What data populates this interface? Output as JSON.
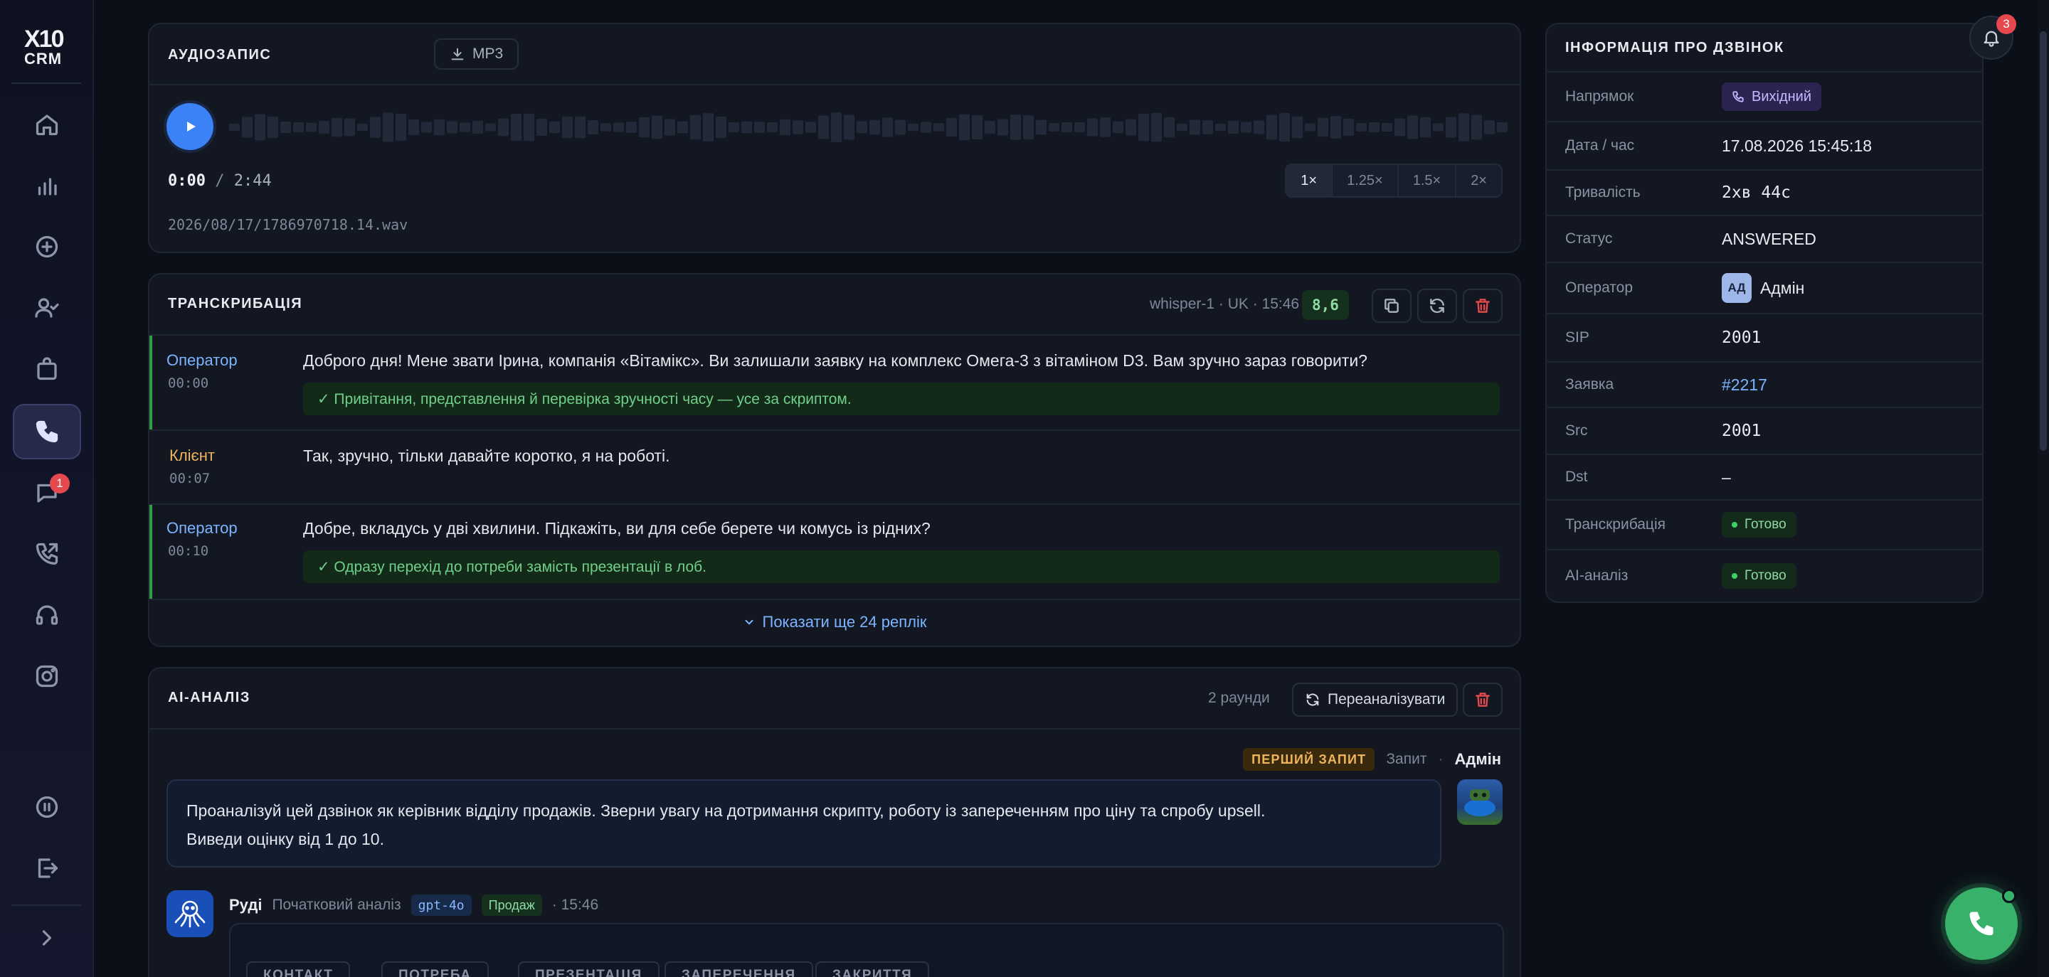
{
  "sidebar": {
    "logo_top": "X10",
    "logo_bottom": "CRM",
    "items": [
      {
        "icon": "home-icon"
      },
      {
        "icon": "chart-icon"
      },
      {
        "icon": "plus-circle-icon"
      },
      {
        "icon": "user-check-icon"
      },
      {
        "icon": "bag-icon"
      },
      {
        "icon": "phone-icon",
        "active": true
      },
      {
        "icon": "chat-icon",
        "badge": "1"
      },
      {
        "icon": "phone-outgoing-icon"
      },
      {
        "icon": "headset-icon"
      },
      {
        "icon": "instagram-icon"
      },
      {
        "icon": "pause-icon"
      },
      {
        "icon": "logout-icon"
      },
      {
        "icon": "chevron-right-icon"
      }
    ]
  },
  "audio": {
    "title": "АУДІОЗАПИС",
    "download_label": "MP3",
    "time_current": "0:00",
    "time_separator": "/",
    "time_total": "2:44",
    "speeds": [
      "1×",
      "1.25×",
      "1.5×",
      "2×"
    ],
    "file_path": "2026/08/17/1786970718.14.wav"
  },
  "transcription": {
    "title": "ТРАНСКРИБАЦІЯ",
    "meta": "whisper-1 · UK · 15:46",
    "score": "8,6",
    "rows": [
      {
        "role": "Оператор",
        "time": "00:00",
        "text": "Доброго дня! Мене звати Ірина, компанія «Вітамікс». Ви залишали заявку на комплекс Омега-3 з вітаміном D3. Вам зручно зараз говорити?",
        "note": "✓  Привітання, представлення й перевірка зручності часу — усе за скриптом."
      },
      {
        "role": "Клієнт",
        "time": "00:07",
        "text": "Так, зручно, тільки давайте коротко, я на роботі."
      },
      {
        "role": "Оператор",
        "time": "00:10",
        "text": "Добре, вкладусь у дві хвилини. Підкажіть, ви для себе берете чи комусь із рідних?",
        "note": "✓  Одразу перехід до потреби замість презентації в лоб."
      }
    ],
    "show_more": "Показати ще 24 реплік"
  },
  "ai": {
    "title": "AI-АНАЛІЗ",
    "rounds": "2 раунди",
    "reanalyze_label": "Переаналізувати",
    "request_badge": "ПЕРШИЙ ЗАПИТ",
    "request_label": "Запит",
    "request_dot": "·",
    "request_author": "Адмін",
    "request_text_1": "Проаналізуй цей дзвінок як керівник відділу продажів. Зверни увагу на дотримання скрипту, роботу із запереченням про ціну та спробу upsell.",
    "request_text_2": "Виведи оцінку від 1 до 10.",
    "bot_name": "Руді",
    "bot_subtitle": "Початковий аналіз",
    "bot_model": "gpt-4o",
    "bot_tag": "Продаж",
    "bot_time": "· 15:46",
    "tabs": [
      "КОНТАКТ",
      "ПОТРЕБА",
      "ПРЕЗЕНТАЦІЯ",
      "ЗАПЕРЕЧЕННЯ",
      "ЗАКРИТТЯ"
    ]
  },
  "info": {
    "title": "ІНФОРМАЦІЯ ПРО ДЗВІНОК",
    "rows": [
      {
        "key": "Напрямок",
        "value": "Вихідний"
      },
      {
        "key": "Дата / час",
        "value": "17.08.2026 15:45:18"
      },
      {
        "key": "Тривалість",
        "value": "2хв 44с"
      },
      {
        "key": "Статус",
        "value": "ANSWERED"
      },
      {
        "key": "Оператор",
        "value": "Адмін",
        "avatar": "АД"
      },
      {
        "key": "SIP",
        "value": "2001"
      },
      {
        "key": "Заявка",
        "value": "#2217"
      },
      {
        "key": "Src",
        "value": "2001"
      },
      {
        "key": "Dst",
        "value": "–"
      },
      {
        "key": "Транскрибація",
        "value": "Готово"
      },
      {
        "key": "AI-аналіз",
        "value": "Готово"
      }
    ]
  },
  "notifications": {
    "count": "3"
  },
  "colors": {
    "accent": "#3b82f6",
    "operator": "#7cb4ff",
    "client": "#f0b45a",
    "success": "#3fcf6a",
    "danger": "#e5484d",
    "call": "#38b26a"
  }
}
